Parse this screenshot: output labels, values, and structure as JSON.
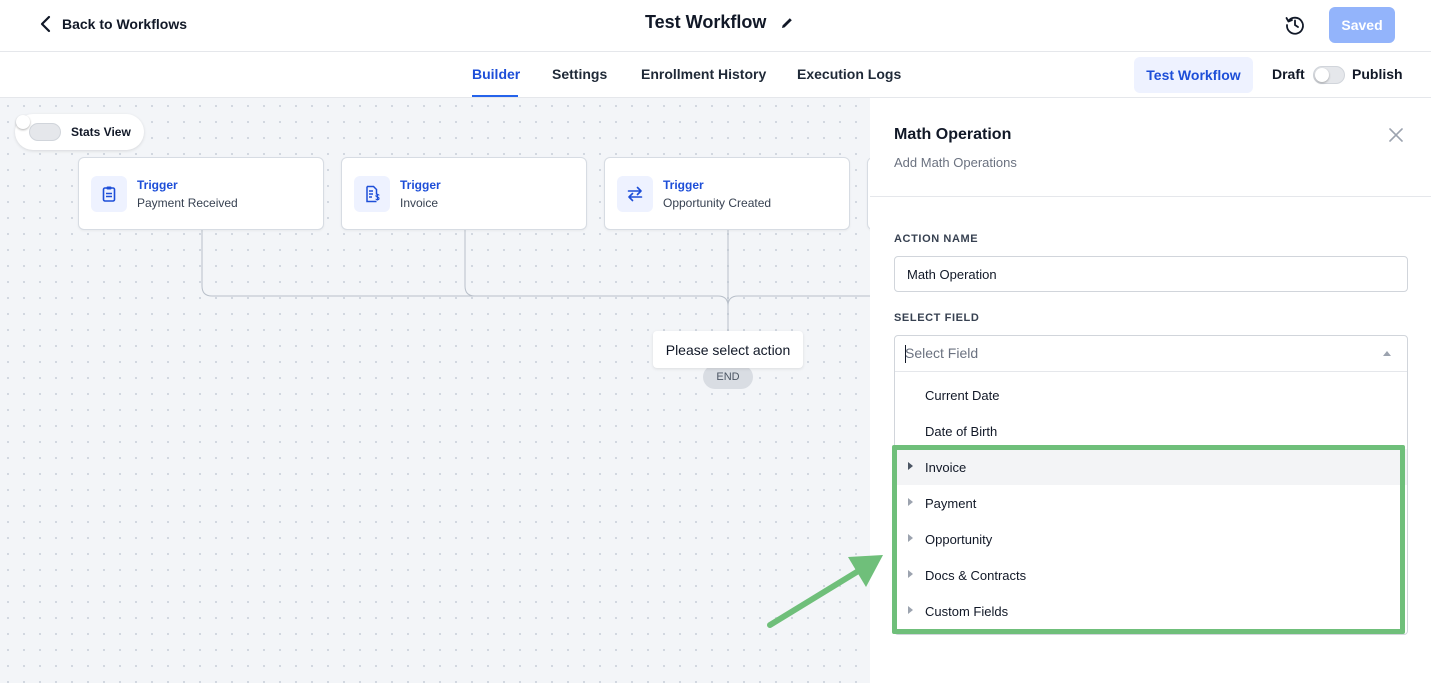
{
  "header": {
    "back_label": "Back to Workflows",
    "title": "Test Workflow",
    "saved_label": "Saved"
  },
  "tabs": [
    {
      "label": "Builder",
      "active": true
    },
    {
      "label": "Settings",
      "active": false
    },
    {
      "label": "Enrollment History",
      "active": false
    },
    {
      "label": "Execution Logs",
      "active": false
    }
  ],
  "toolbar": {
    "test_workflow_label": "Test Workflow",
    "draft_label": "Draft",
    "publish_label": "Publish",
    "published": false
  },
  "canvas": {
    "stats_view_label": "Stats View",
    "stats_view_on": false,
    "triggers": [
      {
        "title": "Trigger",
        "subtitle": "Payment Received",
        "icon": "clipboard-icon"
      },
      {
        "title": "Trigger",
        "subtitle": "Invoice",
        "icon": "invoice-icon"
      },
      {
        "title": "Trigger",
        "subtitle": "Opportunity Created",
        "icon": "swap-arrows-icon"
      }
    ],
    "action_placeholder": "Please select action",
    "end_label": "END"
  },
  "panel": {
    "title": "Math Operation",
    "subtitle": "Add Math Operations",
    "action_name_label": "ACTION NAME",
    "action_name_value": "Math Operation",
    "select_field_label": "SELECT FIELD",
    "select_field_placeholder": "Select Field",
    "options": [
      {
        "label": "Current Date",
        "expandable": false
      },
      {
        "label": "Date of Birth",
        "expandable": false
      },
      {
        "label": "Invoice",
        "expandable": true,
        "hovered": true
      },
      {
        "label": "Payment",
        "expandable": true
      },
      {
        "label": "Opportunity",
        "expandable": true
      },
      {
        "label": "Docs & Contracts",
        "expandable": true
      },
      {
        "label": "Custom Fields",
        "expandable": true
      }
    ]
  },
  "colors": {
    "accent": "#2563eb",
    "saved_button": "#93b4fb",
    "highlight": "#6fbf7a"
  }
}
